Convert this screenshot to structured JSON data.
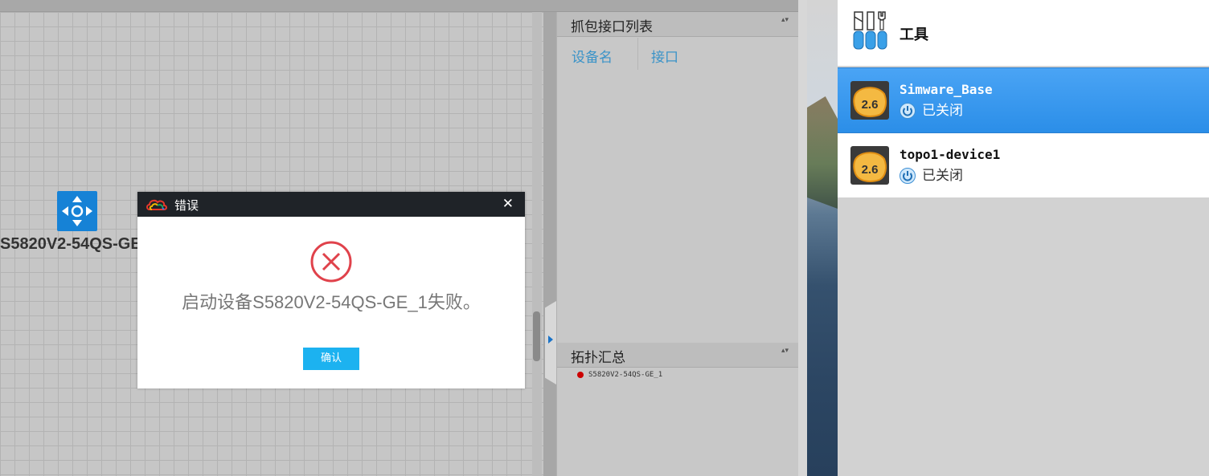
{
  "canvas": {
    "device_label": "S5820V2-54QS-GE_1"
  },
  "capture_panel": {
    "title": "抓包接口列表",
    "columns": [
      "设备名",
      "接口"
    ],
    "sort_glyph": "▴▾"
  },
  "topology_panel": {
    "title": "拓扑汇总",
    "sort_glyph": "▴▾",
    "items": [
      "S5820V2-54QS-GE_1"
    ]
  },
  "app": {
    "tools_label": "工具",
    "vms": [
      {
        "name": "Simware_Base",
        "status": "已关闭",
        "version": "2.6",
        "selected": true
      },
      {
        "name": "topo1-device1",
        "status": "已关闭",
        "version": "2.6",
        "selected": false
      }
    ]
  },
  "dialog": {
    "title": "错误",
    "close_glyph": "✕",
    "message": "启动设备S5820V2-54QS-GE_1失败。",
    "ok_label": "确认"
  },
  "colors": {
    "dialog_bar": "#1f2328",
    "ok_button": "#1cb2f0",
    "error_red": "#e0424b",
    "selected_row": "#2b8ee8",
    "column_text": "#3a93c8"
  }
}
